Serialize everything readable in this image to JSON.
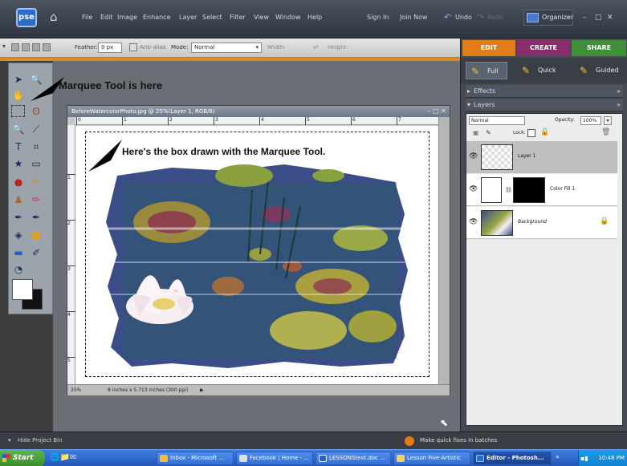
{
  "app": {
    "logo": "pse",
    "menu": [
      "File",
      "Edit",
      "Image",
      "Enhance",
      "Layer",
      "Select",
      "Filter",
      "View",
      "Window",
      "Help"
    ],
    "sign_in": "Sign In",
    "join_now": "Join Now",
    "undo": "Undo",
    "redo": "Redo",
    "organizer": "Organizer"
  },
  "options_bar": {
    "feather_label": "Feather:",
    "feather_value": "0 px",
    "anti_alias": "Anti-alias",
    "mode_label": "Mode:",
    "mode_value": "Normal",
    "width_label": "Width:",
    "height_label": "Height:"
  },
  "annotations": {
    "marquee_tool": "Marquee Tool is here",
    "box_drawn": "Here's the box drawn with the Marquee Tool."
  },
  "document": {
    "title": "BeforeWatercolorPhoto.jpg @ 25%(Layer 1, RGB/8)",
    "ruler_top": [
      "0",
      "1",
      "2",
      "3",
      "4",
      "5",
      "6",
      "7"
    ],
    "ruler_left": [
      "1",
      "2",
      "3",
      "4",
      "5"
    ],
    "zoom": "25%",
    "dimensions": "8 inches x 5.713 inches (300 ppi)"
  },
  "right_panel": {
    "tabs": [
      "EDIT",
      "CREATE",
      "SHARE"
    ],
    "subtabs": [
      "Full",
      "Quick",
      "Guided"
    ],
    "effects_header": "Effects",
    "layers_header": "Layers",
    "blend_mode": "Normal",
    "opacity_label": "Opacity:",
    "opacity_value": "100%",
    "lock_label": "Lock:",
    "layers": [
      {
        "name": "Layer 1"
      },
      {
        "name": "Color Fill 1"
      },
      {
        "name": "Background"
      }
    ]
  },
  "bottom_bar": {
    "hide_project_bin": "Hide Project Bin",
    "tip": "Make quick fixes in batches"
  },
  "taskbar": {
    "start": "Start",
    "tasks": [
      "Inbox - Microsoft ...",
      "Facebook | Home - ...",
      "LESSONStext.doc ...",
      "Lesson Five-Artistic",
      "Editor - Photosh..."
    ],
    "clock": "10:48 PM"
  },
  "colors": {
    "accent_orange": "#e08a1e",
    "edit_tab": "#e07d1a",
    "create_tab": "#8a2f6e",
    "share_tab": "#3f8f3a"
  }
}
